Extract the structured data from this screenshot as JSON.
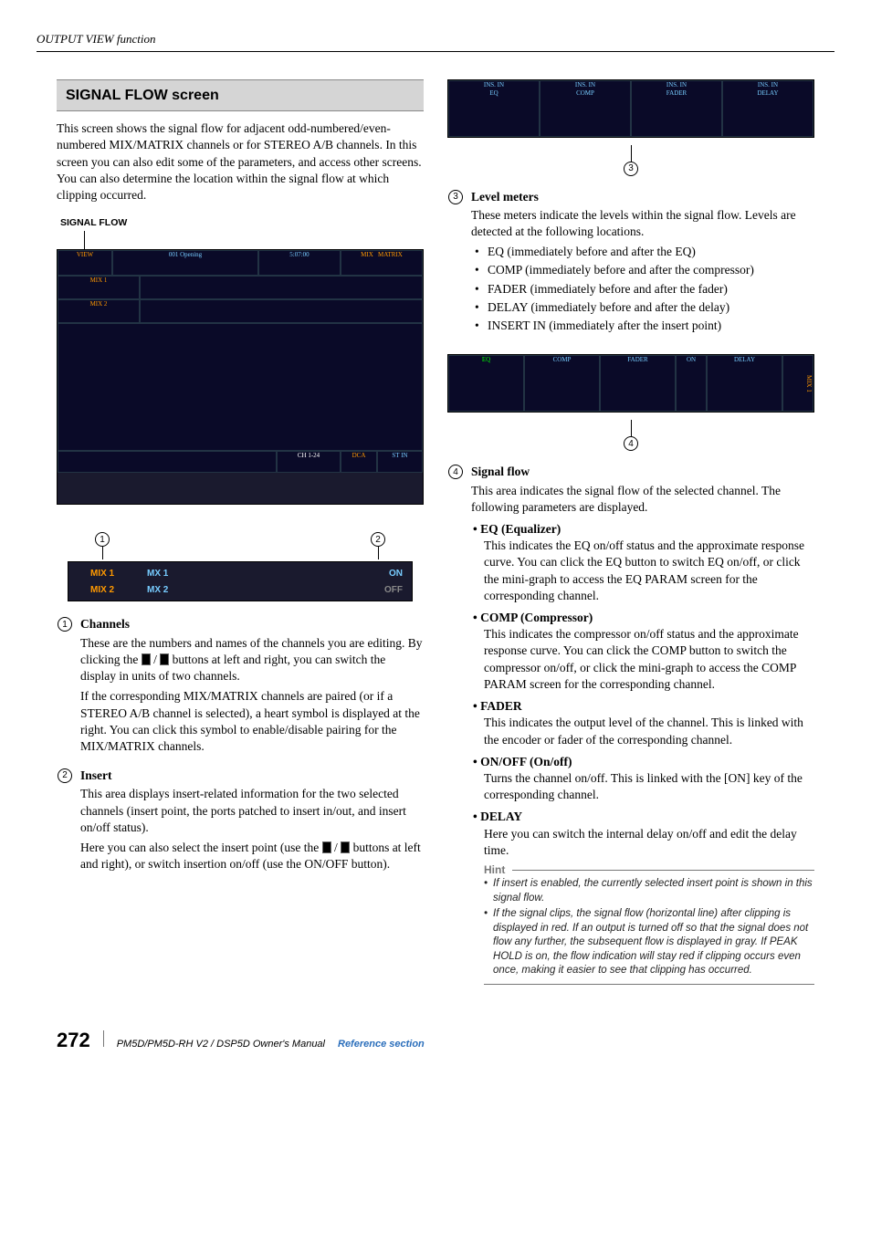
{
  "running_head": "OUTPUT VIEW function",
  "screen_title": "SIGNAL FLOW screen",
  "intro": "This screen shows the signal flow for adjacent odd-numbered/even-numbered MIX/MATRIX channels or for STEREO A/B channels. In this screen you can also edit some of the parameters, and access other screens. You can also determine the location within the signal flow at which clipping occurred.",
  "caption_signal_flow": "SIGNAL FLOW",
  "callouts": {
    "c1": "1",
    "c2": "2",
    "c3": "3",
    "c4": "4"
  },
  "item1": {
    "title": "Channels",
    "p1a": "These are the numbers and names of the channels you are editing. By clicking the ",
    "p1b": " / ",
    "p1c": " buttons at left and right, you can switch the display in units of two channels.",
    "p2": "If the corresponding MIX/MATRIX channels are paired (or if a STEREO A/B channel is selected), a heart symbol is displayed at the right. You can click this symbol to enable/disable pairing for the MIX/MATRIX channels."
  },
  "item2": {
    "title": "Insert",
    "p1": "This area displays insert-related information for the two selected channels (insert point, the ports patched to insert in/out, and insert on/off status).",
    "p2a": "Here you can also select the insert point (use the ",
    "p2b": " / ",
    "p2c": " buttons at left and right), or switch insertion on/off (use the ON/OFF button)."
  },
  "item3": {
    "title": "Level meters",
    "intro": "These meters indicate the levels within the signal flow. Levels are detected at the following locations.",
    "bullets": [
      "EQ (immediately before and after the EQ)",
      "COMP (immediately before and after the compressor)",
      "FADER (immediately before and after the fader)",
      "DELAY (immediately before and after the delay)",
      "INSERT IN (immediately after the insert point)"
    ]
  },
  "item4": {
    "title": "Signal flow",
    "intro": "This area indicates the signal flow of the selected channel. The following parameters are displayed.",
    "subs": [
      {
        "head": "EQ (Equalizer)",
        "body": "This indicates the EQ on/off status and the approximate response curve. You can click the EQ button to switch EQ on/off, or click the mini-graph to access the EQ PARAM screen for the corresponding channel."
      },
      {
        "head": "COMP (Compressor)",
        "body": "This indicates the compressor on/off status and the approximate response curve. You can click the COMP button to switch the compressor on/off, or click the mini-graph to access the COMP PARAM screen for the corresponding channel."
      },
      {
        "head": "FADER",
        "body": "This indicates the output level of the channel. This is linked with the encoder or fader of the corresponding channel."
      },
      {
        "head": "ON/OFF (On/off)",
        "body": "Turns the channel on/off. This is linked with the [ON] key of the corresponding channel."
      },
      {
        "head": "DELAY",
        "body": "Here you can switch the internal delay on/off and edit the delay time."
      }
    ]
  },
  "hint_label": "Hint",
  "hints": [
    "If insert is enabled, the currently selected insert point is shown in this signal flow.",
    "If the signal clips, the signal flow (horizontal line) after clipping is displayed in red. If an output is turned off so that the signal does not flow any further, the subsequent flow is displayed in gray. If PEAK HOLD is on, the flow indication will stay red if clipping occurs even once, making it easier to see that clipping has occurred."
  ],
  "footer": {
    "page": "272",
    "manual": "PM5D/PM5D-RH V2 / DSP5D Owner's Manual",
    "section": "Reference section"
  },
  "fake": {
    "eq": "EQ",
    "comp": "COMP",
    "fader": "FADER",
    "delay": "DELAY",
    "insin": "INS. IN",
    "on": "ON",
    "off": "OFF",
    "mix1": "MIX  1",
    "mix2": "MIX  2",
    "mx1": "MX  1",
    "mx2": "MX  2"
  }
}
